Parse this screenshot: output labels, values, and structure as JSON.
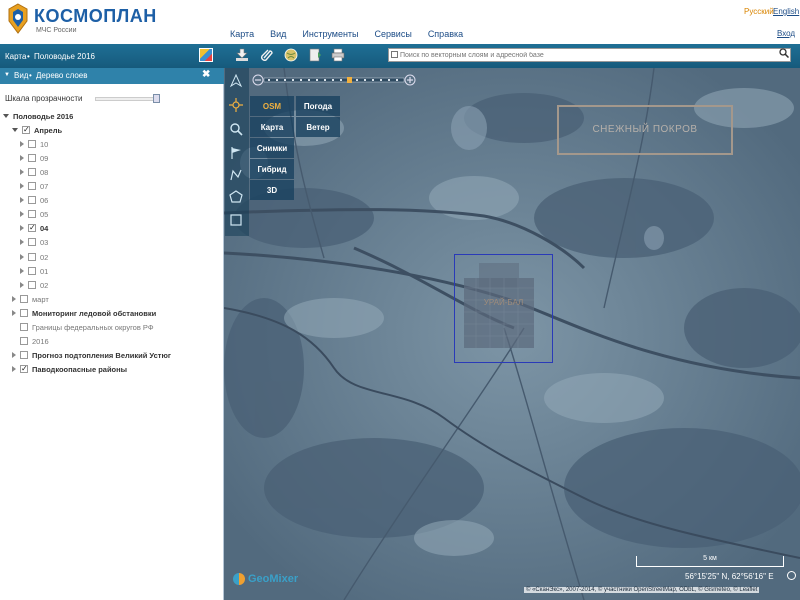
{
  "header": {
    "brand_title": "КОСМОПЛАН",
    "brand_sub": "МЧС России",
    "menu": [
      "Карта",
      "Вид",
      "Инструменты",
      "Сервисы",
      "Справка"
    ],
    "lang_ru": "Русский",
    "lang_en": "English",
    "login": "Вход"
  },
  "breadcrumb": {
    "map": "Карта",
    "sep": "•",
    "current": "Половодье 2016"
  },
  "panel_tabs": {
    "view": "Вид",
    "sep": "•",
    "tree": "Дерево слоев"
  },
  "search": {
    "placeholder": "Поиск по векторным слоям и адресной базе"
  },
  "transparency": {
    "label": "Шкала прозрачности",
    "value": 1.0
  },
  "layer_tree": [
    {
      "label": "Половодье 2016",
      "level": 0,
      "checkbox": false,
      "arrow": "open",
      "style": "bold"
    },
    {
      "label": "Апрель",
      "level": 1,
      "checkbox": true,
      "checked": true,
      "arrow": "open",
      "style": "bold"
    },
    {
      "label": "10",
      "level": 2,
      "checkbox": true,
      "checked": false,
      "arrow": "closed",
      "style": "normal"
    },
    {
      "label": "09",
      "level": 2,
      "checkbox": true,
      "checked": false,
      "arrow": "closed",
      "style": "normal"
    },
    {
      "label": "08",
      "level": 2,
      "checkbox": true,
      "checked": false,
      "arrow": "closed",
      "style": "normal"
    },
    {
      "label": "07",
      "level": 2,
      "checkbox": true,
      "checked": false,
      "arrow": "closed",
      "style": "normal"
    },
    {
      "label": "06",
      "level": 2,
      "checkbox": true,
      "checked": false,
      "arrow": "closed",
      "style": "normal"
    },
    {
      "label": "05",
      "level": 2,
      "checkbox": true,
      "checked": false,
      "arrow": "closed",
      "style": "normal"
    },
    {
      "label": "04",
      "level": 2,
      "checkbox": true,
      "checked": true,
      "arrow": "closed",
      "style": "bold"
    },
    {
      "label": "03",
      "level": 2,
      "checkbox": true,
      "checked": false,
      "arrow": "closed",
      "style": "normal"
    },
    {
      "label": "02",
      "level": 2,
      "checkbox": true,
      "checked": false,
      "arrow": "closed",
      "style": "normal"
    },
    {
      "label": "01",
      "level": 2,
      "checkbox": true,
      "checked": false,
      "arrow": "closed",
      "style": "normal"
    },
    {
      "label": "02",
      "level": 2,
      "checkbox": true,
      "checked": false,
      "arrow": "closed",
      "style": "normal"
    },
    {
      "label": "март",
      "level": 1,
      "checkbox": true,
      "checked": false,
      "arrow": "closed",
      "style": "normal"
    },
    {
      "label": "Мониторинг ледовой обстановки",
      "level": 1,
      "checkbox": true,
      "checked": false,
      "arrow": "closed",
      "style": "semibold"
    },
    {
      "label": "Границы федеральных округов РФ",
      "level": 1,
      "checkbox": true,
      "checked": false,
      "arrow": "none",
      "style": "normal"
    },
    {
      "label": "2016",
      "level": 1,
      "checkbox": true,
      "checked": false,
      "arrow": "none",
      "style": "normal"
    },
    {
      "label": "Прогноз подтопления Великий Устюг",
      "level": 1,
      "checkbox": true,
      "checked": false,
      "arrow": "closed",
      "style": "semibold"
    },
    {
      "label": "Паводкоопасные районы",
      "level": 1,
      "checkbox": true,
      "checked": true,
      "arrow": "closed",
      "style": "bold"
    }
  ],
  "base_layers": {
    "osm": "OSM",
    "weather": "Погода",
    "map": "Карта",
    "wind": "Ветер",
    "satellite": "Снимки",
    "hybrid": "Гибрид",
    "three_d": "3D",
    "active": "OSM"
  },
  "map_overlay": {
    "snow_label": "СНЕЖНЫЙ ПОКРОВ",
    "city_label": "УРАЙ-БАЛ"
  },
  "footer": {
    "geomixer": "GeoMixer",
    "scale": "5 км",
    "coords": "56°15'25\" N, 62°56'16\" E",
    "copyright": "© «СканЭкс», 2007-2014, © участники OpenStreetMap, ODbL, © Gismeteo, © Leaflet"
  },
  "colors": {
    "brand": "#1d5fa6",
    "toolbar": "#1f6f95",
    "panel_header": "#2f82aa",
    "active_layer": "#f0b040"
  }
}
